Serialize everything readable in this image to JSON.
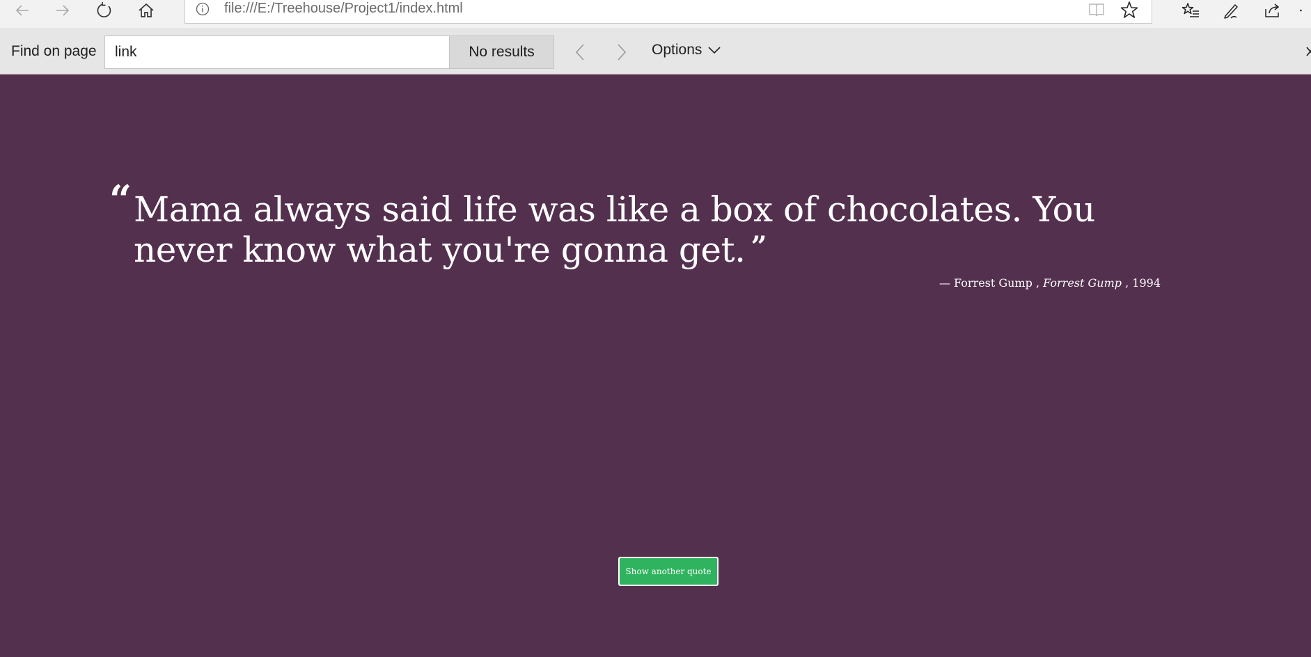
{
  "browser": {
    "url": "file:///E:/Treehouse/Project1/index.html",
    "icons": {
      "back": "back-arrow-icon",
      "forward": "forward-arrow-icon",
      "refresh": "refresh-icon",
      "home": "home-icon",
      "site_info": "info-icon",
      "reading_view": "reading-view-icon",
      "favorite": "star-icon",
      "favorites_hub": "favorites-list-icon",
      "web_note": "pen-icon",
      "share": "share-icon"
    }
  },
  "find_bar": {
    "label": "Find on page",
    "query": "link",
    "results": "No results",
    "options_label": "Options"
  },
  "quote": {
    "text": "Mama always said life was like a box of chocolates. You never know what you're gonna get.",
    "open_mark": "“",
    "close_mark": "”",
    "source_prefix": "— Forrest Gump ,",
    "citation": "Forrest Gump",
    "year_suffix": ", 1994"
  },
  "button": {
    "label": "Show another quote"
  },
  "colors": {
    "page_background": "#54304f",
    "button_background": "#2fb35e",
    "toolbar_background": "#f2f2f2",
    "findbar_background": "#e6e6e6"
  }
}
